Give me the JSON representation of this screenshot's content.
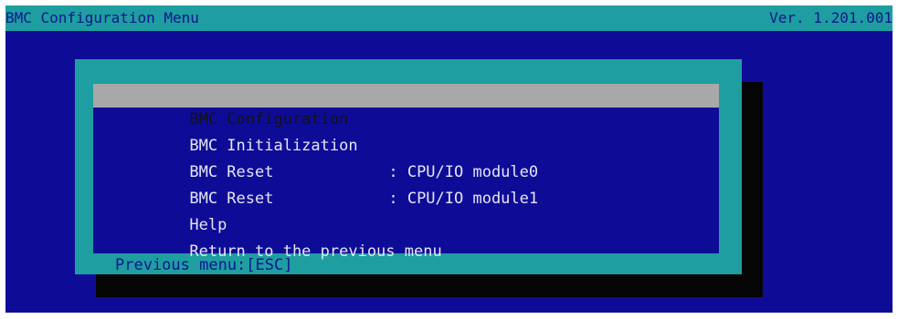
{
  "header": {
    "title": "BMC Configuration Menu",
    "version": "Ver. 1.201.001"
  },
  "menu": {
    "items": [
      {
        "label": "BMC Configuration",
        "value": "",
        "selected": true
      },
      {
        "label": "BMC Initialization",
        "value": "",
        "selected": false
      },
      {
        "label": "BMC Reset",
        "value": ": CPU/IO module0",
        "selected": false
      },
      {
        "label": "BMC Reset",
        "value": ": CPU/IO module1",
        "selected": false
      },
      {
        "label": "Help",
        "value": "",
        "selected": false
      },
      {
        "label": "Return to the previous menu",
        "value": "",
        "selected": false
      }
    ],
    "footer_hint": "Previous menu:[ESC]"
  },
  "colors": {
    "background": "#0e0c97",
    "frame": "#1e9ea0",
    "highlight": "#a8a8a8",
    "text": "#e6e6f2",
    "shadow": "#050505"
  }
}
